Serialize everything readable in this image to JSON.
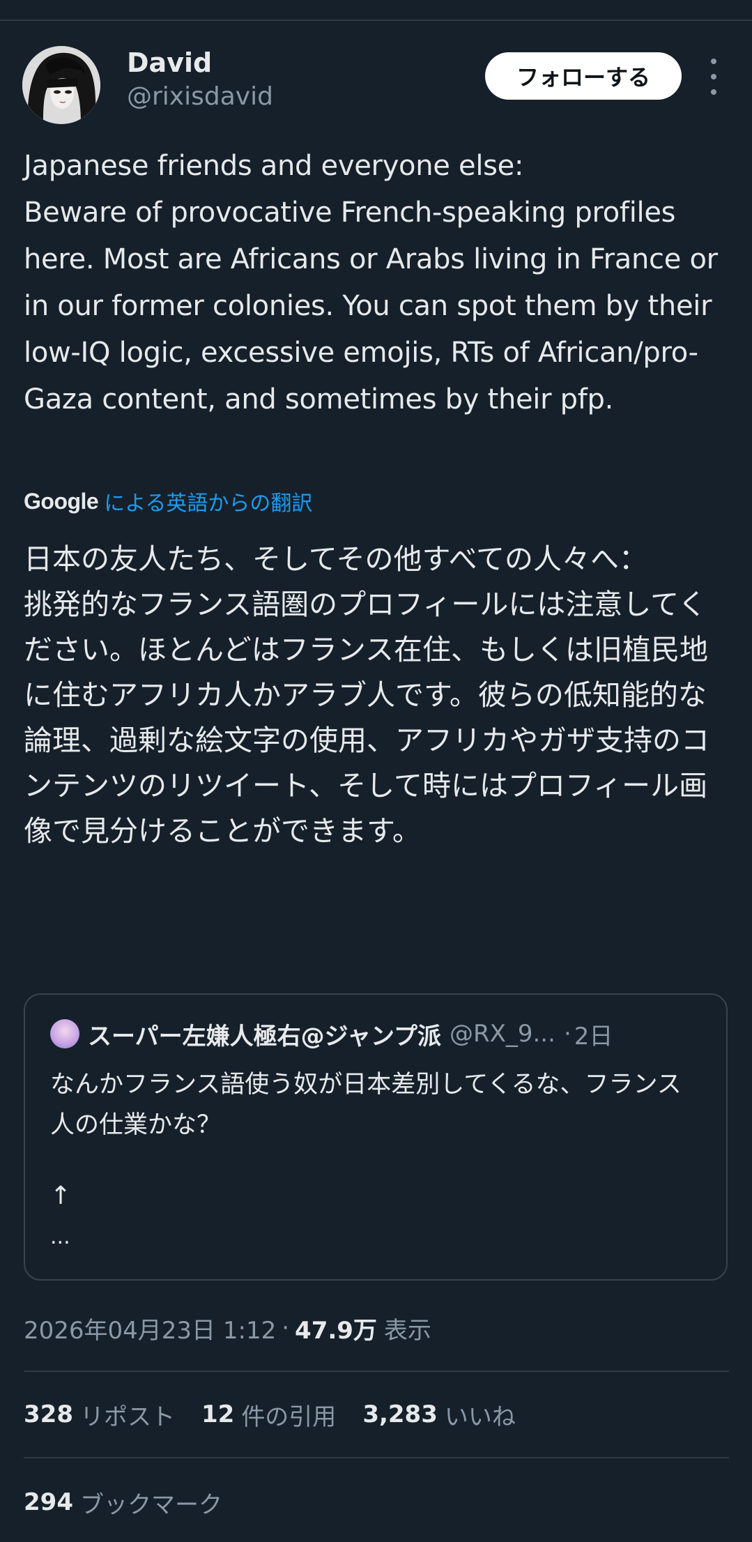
{
  "author": {
    "name": "David",
    "handle": "@rixisdavid"
  },
  "follow_button_label": "フォローする",
  "tweet_text": "Japanese friends and everyone else:\nBeware of provocative French-speaking profiles here. Most are Africans or Arabs living in France or in our former colonies. You can spot them by their low-IQ logic, excessive emojis, RTs of African/pro-Gaza content, and sometimes by their pfp.",
  "translation": {
    "provider": "Google",
    "label": "による英語からの翻訳",
    "text": "日本の友人たち、そしてその他すべての人々へ：\n挑発的なフランス語圏のプロフィールには注意してください。ほとんどはフランス在住、もしくは旧植民地に住むアフリカ人かアラブ人です。彼らの低知能的な論理、過剰な絵文字の使用、アフリカやガザ支持のコンテンツのリツイート、そして時にはプロフィール画像で見分けることができます。"
  },
  "quoted_tweet": {
    "name": "スーパー左嫌人極右@ジャンプ派",
    "handle": "@RX_9...",
    "separator": "·",
    "time": "2日",
    "text": "なんかフランス語使う奴が日本差別してくるな、フランス人の仕業かな？",
    "arrow": "↑",
    "ellipsis": "..."
  },
  "meta": {
    "timestamp": "2026年04月23日 1:12",
    "separator": "·",
    "views": "47.9万",
    "views_label": "表示"
  },
  "stats": {
    "reposts": "328",
    "reposts_label": "リポスト",
    "quotes": "12",
    "quotes_label": "件の引用",
    "likes": "3,283",
    "likes_label": "いいね",
    "bookmarks": "294",
    "bookmarks_label": "ブックマーク"
  },
  "colors": {
    "background": "#15202b",
    "text": "#e7e9ea",
    "secondary": "#8b98a5",
    "link": "#1d9bf0",
    "border": "#38444d"
  },
  "icons": {
    "more": "more-vertical-icon"
  }
}
